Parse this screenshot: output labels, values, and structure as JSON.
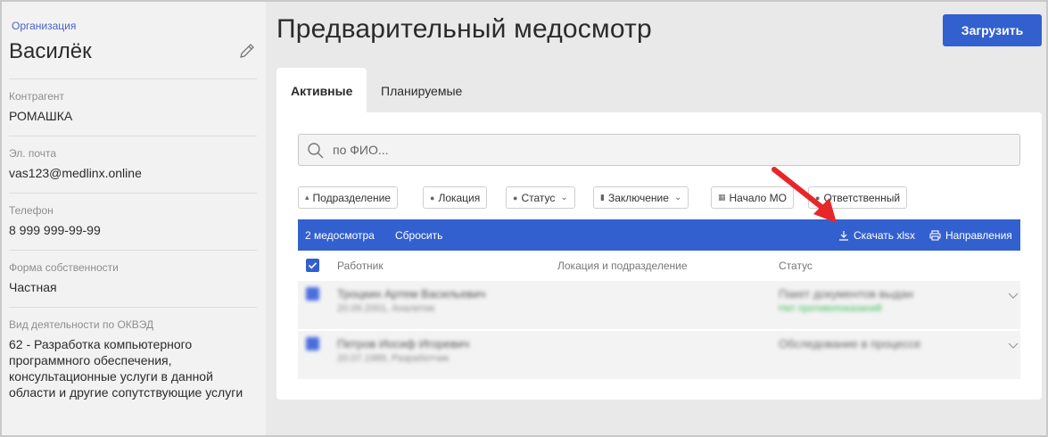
{
  "sidebar": {
    "org_caption": "Организация",
    "org_name": "Василёк",
    "fields": [
      {
        "label": "Контрагент",
        "value": "РОМАШКА"
      },
      {
        "label": "Эл. почта",
        "value": "vas123@medlinx.online"
      },
      {
        "label": "Телефон",
        "value": "8 999 999-99-99"
      },
      {
        "label": "Форма собственности",
        "value": "Частная"
      },
      {
        "label": "Вид деятельности по ОКВЭД",
        "value": "62 - Разработка компьютерного программного обеспечения, консультационные услуги в данной области и другие сопутствующие услуги"
      }
    ]
  },
  "header": {
    "title": "Предварительный медосмотр",
    "upload_label": "Загрузить"
  },
  "tabs": [
    {
      "label": "Активные",
      "active": true
    },
    {
      "label": "Планируемые",
      "active": false
    }
  ],
  "search": {
    "placeholder": "по ФИО..."
  },
  "filters": [
    {
      "label": "Подразделение",
      "icon": "hierarchy-icon"
    },
    {
      "label": "Локация",
      "icon": "location-pin-icon"
    },
    {
      "label": "Статус",
      "icon": "dot-icon"
    },
    {
      "label": "Заключение",
      "icon": "document-icon"
    },
    {
      "label": "Начало МО",
      "icon": "calendar-icon"
    },
    {
      "label": "Ответственный",
      "icon": "person-icon"
    }
  ],
  "selection_bar": {
    "count": "2 медосмотра",
    "reset": "Сбросить",
    "download": "Скачать xlsx",
    "directions": "Направления"
  },
  "table": {
    "columns": [
      "Работник",
      "Локация и подразделение",
      "Статус"
    ],
    "rows": [
      {
        "name": "Троцкин Артем Васильевич",
        "sub": "20.09.2001, Аналитик",
        "status": "Пакет документов выдан",
        "status_sub": "Нет противопоказаний"
      },
      {
        "name": "Петров Иосиф Игоревич",
        "sub": "20.07.1989, Разработчик",
        "status": "Обследование в процессе",
        "status_sub": ""
      }
    ]
  },
  "colors": {
    "accent": "#3360cf",
    "annotation_arrow": "#e8262a",
    "status_ok": "#3bbf5a"
  }
}
